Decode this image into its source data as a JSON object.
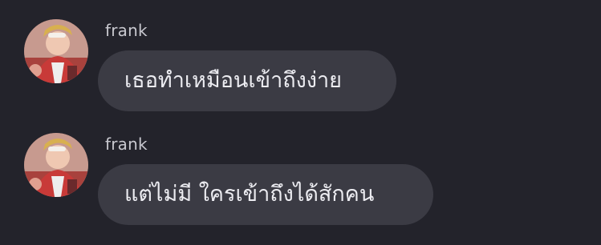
{
  "messages": [
    {
      "sender": "frank",
      "text": "เธอทำเหมือนเข้าถึงง่าย",
      "avatar_icon": "user-avatar-photo"
    },
    {
      "sender": "frank",
      "text": "แต่ไม่มี ใครเข้าถึงได้สักคน",
      "avatar_icon": "user-avatar-photo"
    }
  ],
  "colors": {
    "background": "#23232b",
    "bubble": "#3b3b44",
    "sender_text": "#c8c8cf",
    "message_text": "#ececf1"
  }
}
